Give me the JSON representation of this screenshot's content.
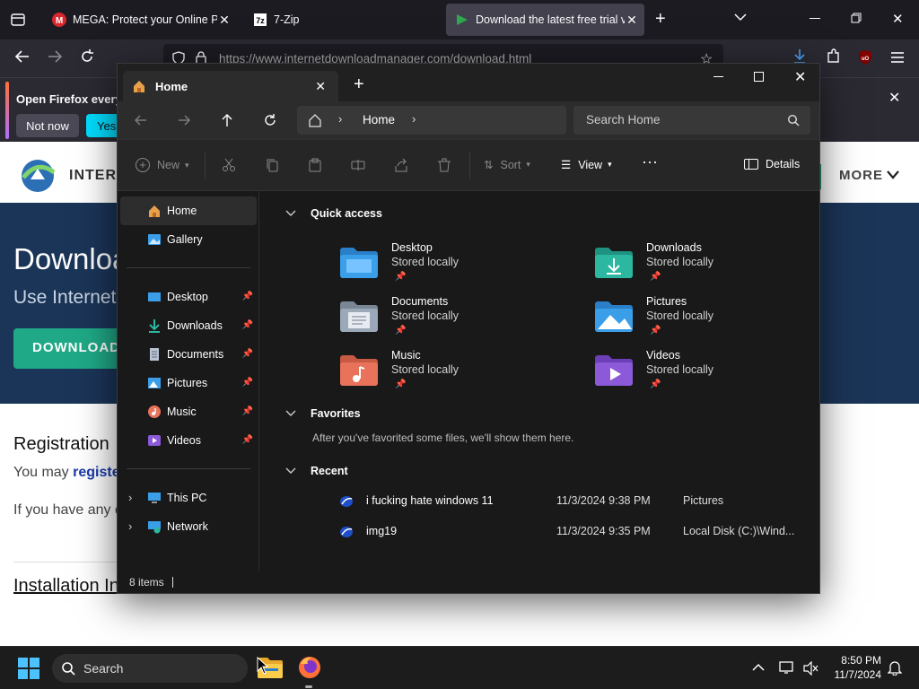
{
  "firefox": {
    "tabs": [
      {
        "title": "MEGA: Protect your Online Privacy",
        "favicon": "mega-icon"
      },
      {
        "title": "7-Zip",
        "favicon": "7zip-icon"
      },
      {
        "title": "Download the latest free trial version",
        "favicon": "idm-icon",
        "active": true
      }
    ],
    "url": "https://www.internetdownloadmanager.com/download.html",
    "notification": {
      "text": "Open Firefox every",
      "not_now": "Not now",
      "yes": "Yes,"
    }
  },
  "website": {
    "brand": "INTERN",
    "more": "MORE",
    "hero_title": "Downloa",
    "hero_sub": "Use Internet D",
    "download_button": "DOWNLOAD",
    "registration_title": "Registration",
    "registration_text": "You may ",
    "registration_link": "registe",
    "if_text": "If you have any q",
    "installation": "Installation In"
  },
  "explorer": {
    "tab_title": "Home",
    "breadcrumb": "Home",
    "search_placeholder": "Search Home",
    "toolbar": {
      "new": "New",
      "sort": "Sort",
      "view": "View",
      "details": "Details"
    },
    "nav": [
      {
        "label": "Home",
        "icon": "home-icon",
        "selected": true
      },
      {
        "label": "Gallery",
        "icon": "gallery-icon"
      },
      {
        "label": "Desktop",
        "icon": "desktop-icon",
        "pinned": true
      },
      {
        "label": "Downloads",
        "icon": "downloads-icon",
        "pinned": true
      },
      {
        "label": "Documents",
        "icon": "documents-icon",
        "pinned": true
      },
      {
        "label": "Pictures",
        "icon": "pictures-icon",
        "pinned": true
      },
      {
        "label": "Music",
        "icon": "music-icon",
        "pinned": true
      },
      {
        "label": "Videos",
        "icon": "videos-icon",
        "pinned": true
      },
      {
        "label": "This PC",
        "icon": "this-pc-icon"
      },
      {
        "label": "Network",
        "icon": "network-icon"
      }
    ],
    "quick_access_title": "Quick access",
    "quick_access": [
      {
        "name": "Desktop",
        "status": "Stored locally",
        "color": "#3a9ee8"
      },
      {
        "name": "Downloads",
        "status": "Stored locally",
        "color": "#2bb7a0"
      },
      {
        "name": "Documents",
        "status": "Stored locally",
        "color": "#9aa8b8"
      },
      {
        "name": "Pictures",
        "status": "Stored locally",
        "color": "#3a9ee8"
      },
      {
        "name": "Music",
        "status": "Stored locally",
        "color": "#e8735a"
      },
      {
        "name": "Videos",
        "status": "Stored locally",
        "color": "#8c5ad8"
      }
    ],
    "favorites_title": "Favorites",
    "favorites_empty": "After you've favorited some files, we'll show them here.",
    "recent_title": "Recent",
    "recent": [
      {
        "name": "i fucking hate windows 11",
        "date": "11/3/2024 9:38 PM",
        "location": "Pictures"
      },
      {
        "name": "img19",
        "date": "11/3/2024 9:35 PM",
        "location": "Local Disk (C:)\\Wind..."
      }
    ],
    "status": "8 items"
  },
  "taskbar": {
    "search": "Search",
    "time": "8:50 PM",
    "date": "11/7/2024"
  }
}
